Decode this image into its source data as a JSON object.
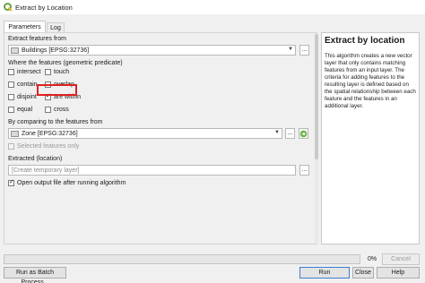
{
  "window": {
    "title": "Extract by Location"
  },
  "tabs": [
    {
      "label": "Parameters"
    },
    {
      "label": "Log"
    }
  ],
  "form": {
    "extract_label": "Extract features from",
    "extract_layer": "Buildings [EPSG:32736]",
    "predicate_label": "Where the features (geometric predicate)",
    "predicates": [
      {
        "label": "intersect",
        "checked": false
      },
      {
        "label": "touch",
        "checked": false
      },
      {
        "label": "contain",
        "checked": false
      },
      {
        "label": "overlap",
        "checked": false
      },
      {
        "label": "disjoint",
        "checked": false
      },
      {
        "label": "are within",
        "checked": true
      },
      {
        "label": "equal",
        "checked": false
      },
      {
        "label": "cross",
        "checked": false
      }
    ],
    "compare_label": "By comparing to the features from",
    "compare_layer": "Zone [EPSG:32736]",
    "selected_only_label": "Selected features only",
    "extracted_label": "Extracted (location)",
    "extracted_placeholder": "[Create temporary layer]",
    "open_output_label": "Open output file after running algorithm",
    "dots": "...",
    "combo_arrow": "▼"
  },
  "help": {
    "title": "Extract by location",
    "body": "This algorithm creates a new vector layer that only contains matching features from an input layer. The criteria for adding features to the resulting layer is defined based on the spatial relationship between each feature and the features in an additional layer."
  },
  "footer": {
    "progress": 0,
    "progress_label": "0%",
    "cancel_label": "Cancel",
    "batch_label": "Run as Batch Process...",
    "run_label": "Run",
    "close_label": "Close",
    "help_label": "Help"
  }
}
